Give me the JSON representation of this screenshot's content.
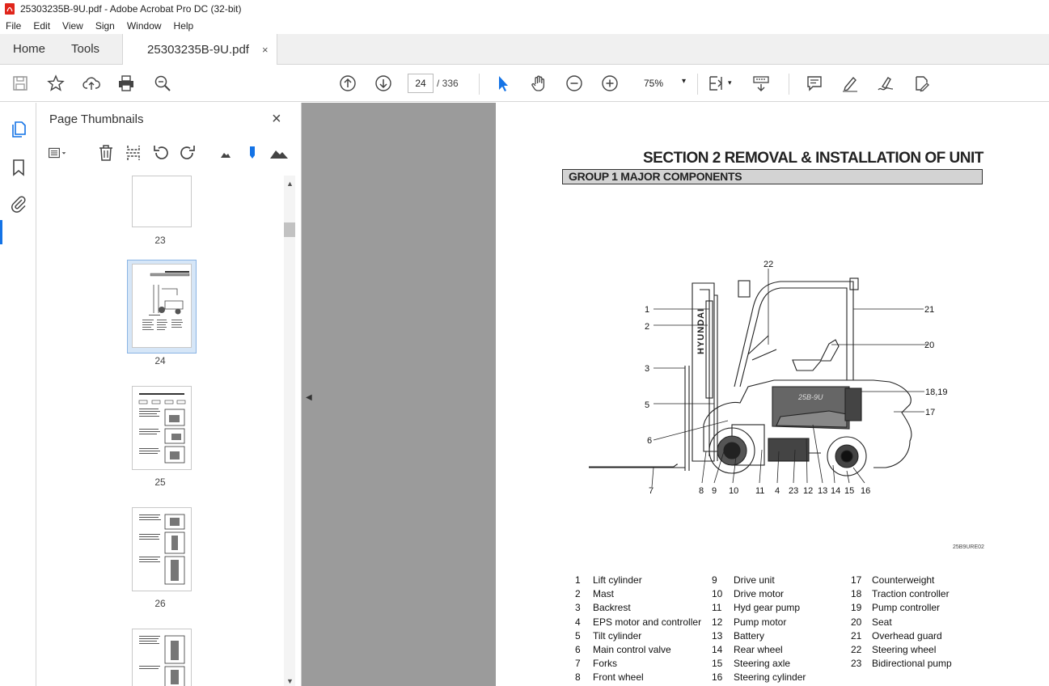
{
  "window": {
    "title": "25303235B-9U.pdf - Adobe Acrobat Pro DC (32-bit)"
  },
  "menu": [
    "File",
    "Edit",
    "View",
    "Sign",
    "Window",
    "Help"
  ],
  "tabs": {
    "home": "Home",
    "tools": "Tools",
    "document": "25303235B-9U.pdf",
    "close": "×"
  },
  "toolbar": {
    "page_current": "24",
    "page_total": "/ 336",
    "zoom": "75%"
  },
  "panel": {
    "title": "Page Thumbnails",
    "close": "×",
    "thumbnails": [
      {
        "label": "23"
      },
      {
        "label": "24",
        "selected": true
      },
      {
        "label": "25"
      },
      {
        "label": "26"
      }
    ]
  },
  "document": {
    "section_title": "SECTION  2  REMOVAL & INSTALLATION OF UNIT",
    "group_title": "GROUP  1  MAJOR COMPONENTS",
    "figure_code": "25B9URE02",
    "brand_text": "HYUNDAI",
    "model_text": "25B-9U",
    "callouts": [
      "1",
      "2",
      "3",
      "5",
      "6",
      "7",
      "8",
      "9",
      "10",
      "11",
      "4",
      "23",
      "12",
      "13",
      "14",
      "15",
      "16",
      "17",
      "18,19",
      "20",
      "21",
      "22"
    ],
    "legend": [
      [
        {
          "n": "1",
          "t": "Lift cylinder"
        },
        {
          "n": "2",
          "t": "Mast"
        },
        {
          "n": "3",
          "t": "Backrest"
        },
        {
          "n": "4",
          "t": "EPS motor and controller"
        },
        {
          "n": "5",
          "t": "Tilt cylinder"
        },
        {
          "n": "6",
          "t": "Main control valve"
        },
        {
          "n": "7",
          "t": "Forks"
        },
        {
          "n": "8",
          "t": "Front wheel"
        }
      ],
      [
        {
          "n": "9",
          "t": "Drive unit"
        },
        {
          "n": "10",
          "t": "Drive motor"
        },
        {
          "n": "11",
          "t": "Hyd gear pump"
        },
        {
          "n": "12",
          "t": "Pump motor"
        },
        {
          "n": "13",
          "t": "Battery"
        },
        {
          "n": "14",
          "t": "Rear wheel"
        },
        {
          "n": "15",
          "t": "Steering axle"
        },
        {
          "n": "16",
          "t": "Steering cylinder"
        }
      ],
      [
        {
          "n": "17",
          "t": "Counterweight"
        },
        {
          "n": "18",
          "t": "Traction controller"
        },
        {
          "n": "19",
          "t": "Pump controller"
        },
        {
          "n": "20",
          "t": "Seat"
        },
        {
          "n": "21",
          "t": "Overhead guard"
        },
        {
          "n": "22",
          "t": "Steering wheel"
        },
        {
          "n": "23",
          "t": "Bidirectional pump"
        }
      ]
    ]
  }
}
